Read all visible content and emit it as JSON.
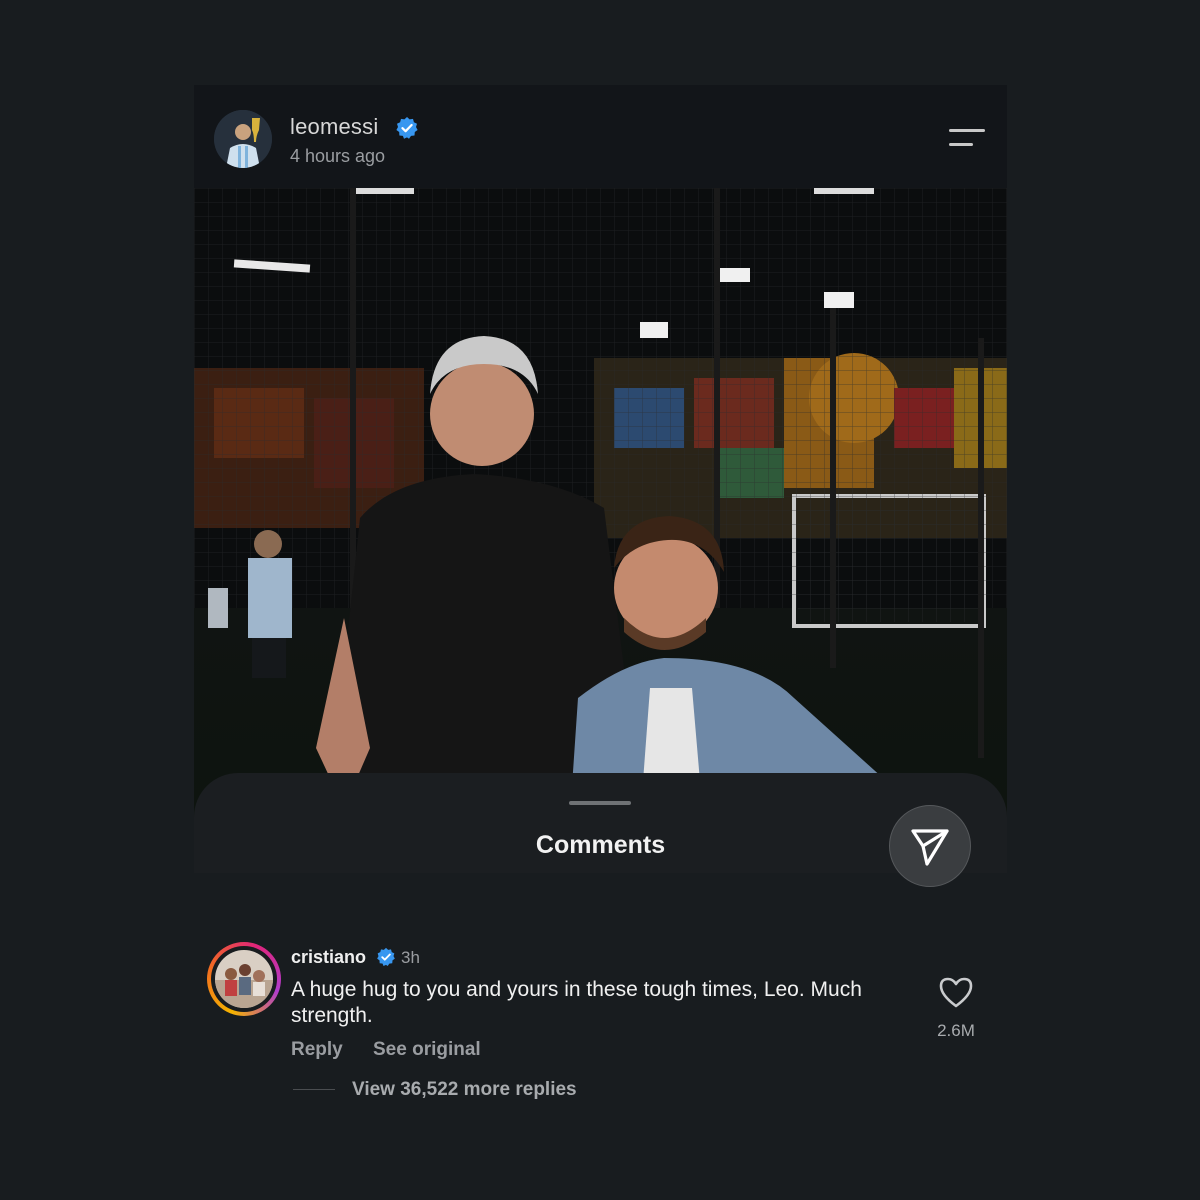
{
  "post": {
    "username": "leomessi",
    "time": "4 hours ago"
  },
  "sheet": {
    "title": "Comments"
  },
  "comment": {
    "username": "cristiano",
    "time": "3h",
    "text": "A huge hug to you and yours in these tough times, Leo. Much strength.",
    "reply_label": "Reply",
    "see_original_label": "See original",
    "likes": "2.6M",
    "view_replies": "View 36,522 more replies"
  },
  "icons": {
    "verified": "verified-badge-icon",
    "menu": "menu-icon",
    "send": "send-icon",
    "like": "heart-icon"
  },
  "colors": {
    "background": "#181c1f",
    "verified_blue": "#3897f0",
    "story_ring": [
      "#f5b300",
      "#f26a22",
      "#e0247a",
      "#b03ccc"
    ]
  }
}
